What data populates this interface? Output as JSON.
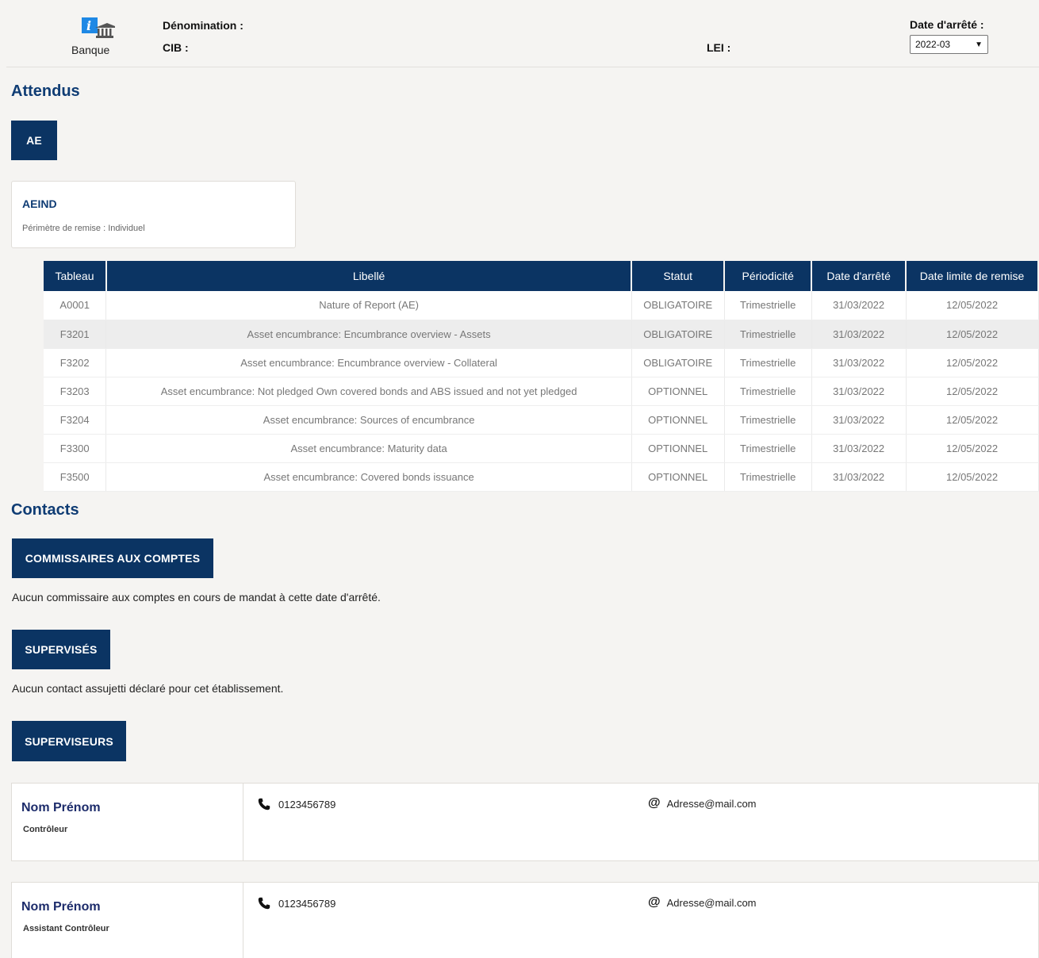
{
  "header": {
    "bank_label": "Banque",
    "denomination_label": "Dénomination :",
    "cib_label": "CIB :",
    "lei_label": "LEI :",
    "date_label": "Date d'arrêté :",
    "date_value": "2022-03"
  },
  "attendus": {
    "title": "Attendus",
    "tab_label": "AE",
    "card": {
      "title": "AEIND",
      "subtitle": "Périmètre de remise : Individuel"
    },
    "table": {
      "columns": [
        "Tableau",
        "Libellé",
        "Statut",
        "Périodicité",
        "Date d'arrêté",
        "Date limite de remise"
      ],
      "rows": [
        [
          "A0001",
          "Nature of Report (AE)",
          "OBLIGATOIRE",
          "Trimestrielle",
          "31/03/2022",
          "12/05/2022"
        ],
        [
          "F3201",
          "Asset encumbrance: Encumbrance overview - Assets",
          "OBLIGATOIRE",
          "Trimestrielle",
          "31/03/2022",
          "12/05/2022"
        ],
        [
          "F3202",
          "Asset encumbrance: Encumbrance overview - Collateral",
          "OBLIGATOIRE",
          "Trimestrielle",
          "31/03/2022",
          "12/05/2022"
        ],
        [
          "F3203",
          "Asset encumbrance: Not pledged Own covered bonds and ABS issued and not yet pledged",
          "OPTIONNEL",
          "Trimestrielle",
          "31/03/2022",
          "12/05/2022"
        ],
        [
          "F3204",
          "Asset encumbrance: Sources of encumbrance",
          "OPTIONNEL",
          "Trimestrielle",
          "31/03/2022",
          "12/05/2022"
        ],
        [
          "F3300",
          "Asset encumbrance: Maturity data",
          "OPTIONNEL",
          "Trimestrielle",
          "31/03/2022",
          "12/05/2022"
        ],
        [
          "F3500",
          "Asset encumbrance: Covered bonds issuance",
          "OPTIONNEL",
          "Trimestrielle",
          "31/03/2022",
          "12/05/2022"
        ]
      ]
    }
  },
  "contacts": {
    "title": "Contacts",
    "commissaires_label": "COMMISSAIRES AUX COMPTES",
    "commissaires_msg": "Aucun commissaire aux comptes en cours de mandat à cette date d'arrêté.",
    "supervises_label": "SUPERVISÉS",
    "supervises_msg": "Aucun contact assujetti déclaré pour cet établissement.",
    "superviseurs_label": "SUPERVISEURS",
    "people": [
      {
        "name": "Nom Prénom",
        "role": "Contrôleur",
        "phone": "0123456789",
        "email": "Adresse@mail.com"
      },
      {
        "name": "Nom Prénom",
        "role": "Assistant Contrôleur",
        "phone": "0123456789",
        "email": "Adresse@mail.com"
      }
    ]
  },
  "colors": {
    "primary": "#0b3463",
    "title": "#0f3c74",
    "background": "#f5f4f2",
    "logo_blue": "#1e88e5"
  },
  "icons": {
    "bank": "bank-info-icon",
    "phone": "phone-icon",
    "email": "at-icon",
    "select": "chevron-down-icon"
  }
}
